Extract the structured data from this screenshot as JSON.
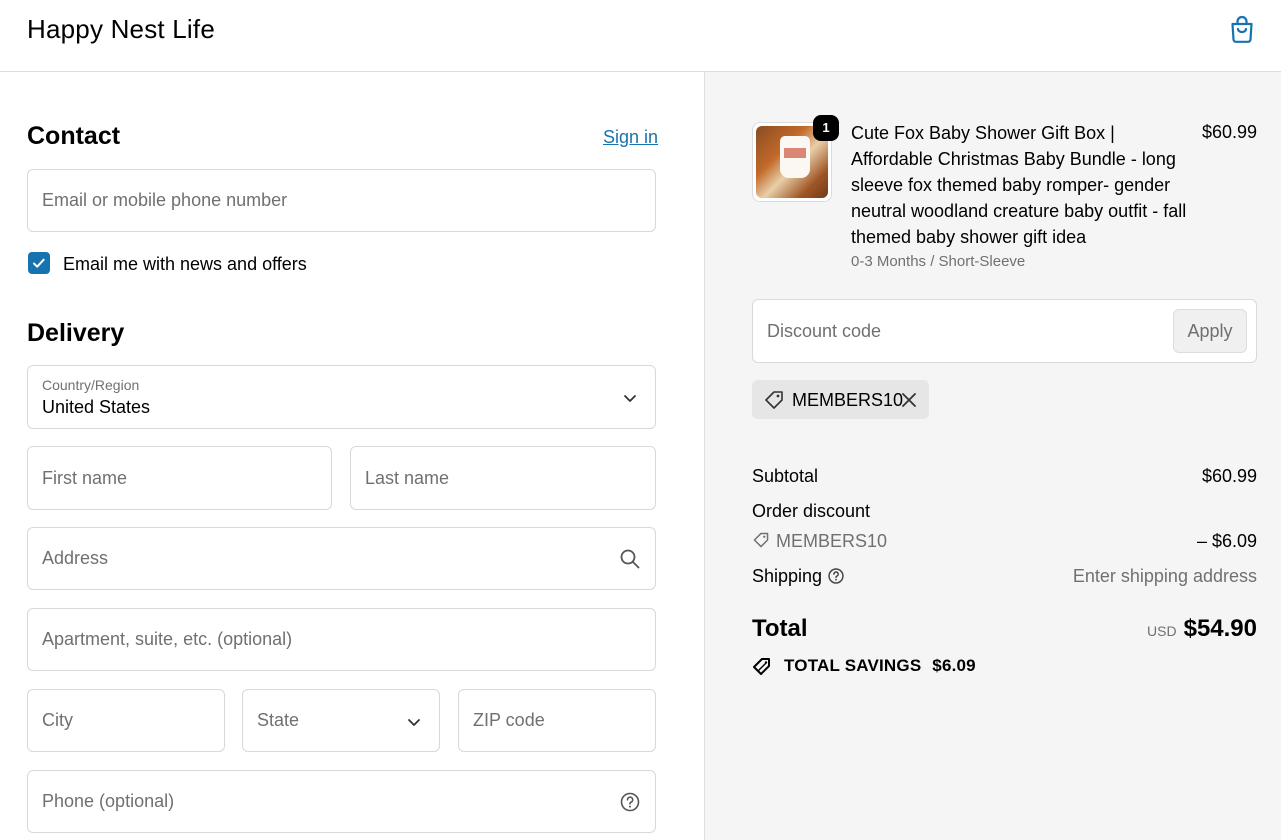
{
  "header": {
    "brand": "Happy Nest Life"
  },
  "contact": {
    "heading": "Contact",
    "sign_in": "Sign in",
    "email_placeholder": "Email or mobile phone number",
    "newsletter_label": "Email me with news and offers",
    "newsletter_checked": true
  },
  "delivery": {
    "heading": "Delivery",
    "country_label": "Country/Region",
    "country_value": "United States",
    "first_name_placeholder": "First name",
    "last_name_placeholder": "Last name",
    "address_placeholder": "Address",
    "apartment_placeholder": "Apartment, suite, etc. (optional)",
    "city_placeholder": "City",
    "state_placeholder": "State",
    "zip_placeholder": "ZIP code",
    "phone_placeholder": "Phone (optional)"
  },
  "order": {
    "item": {
      "quantity": "1",
      "title": "Cute Fox Baby Shower Gift Box | Affordable Christmas Baby Bundle - long sleeve fox themed baby romper- gender neutral woodland creature baby outfit - fall themed baby shower gift idea",
      "variant": "0-3 Months / Short-Sleeve",
      "price": "$60.99"
    },
    "discount_placeholder": "Discount code",
    "apply_label": "Apply",
    "applied_code": "MEMBERS10",
    "subtotal_label": "Subtotal",
    "subtotal_value": "$60.99",
    "order_discount_label": "Order discount",
    "discount_code_line": "MEMBERS10",
    "discount_value": "– $6.09",
    "shipping_label": "Shipping",
    "shipping_value": "Enter shipping address",
    "total_label": "Total",
    "currency": "USD",
    "total_value": "$54.90",
    "savings_label": "TOTAL SAVINGS",
    "savings_value": "$6.09"
  },
  "colors": {
    "accent": "#1773b0",
    "summary_bg": "#f5f5f5",
    "muted_text": "#707070"
  }
}
